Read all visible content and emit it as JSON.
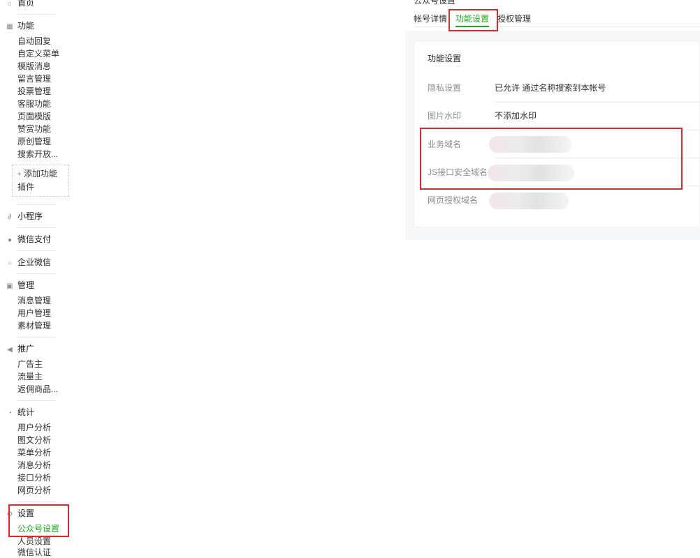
{
  "sidebar": {
    "home": {
      "label": "首页",
      "icon": "home-icon"
    },
    "functions": {
      "label": "功能",
      "icon": "grid-icon",
      "items": [
        "自动回复",
        "自定义菜单",
        "模版消息",
        "留言管理",
        "投票管理",
        "客服功能",
        "页面模版",
        "赞赏功能",
        "原创管理",
        "搜索开放..."
      ],
      "add_plugin": {
        "line1": "添加功能",
        "line2": "插件"
      }
    },
    "mini_program": {
      "label": "小程序",
      "icon": "link-icon"
    },
    "wechat_pay": {
      "label": "微信支付",
      "icon": "pay-icon"
    },
    "enterprise_wechat": {
      "label": "企业微信",
      "icon": "search-circle-icon"
    },
    "manage": {
      "label": "管理",
      "icon": "inbox-icon",
      "items": [
        "消息管理",
        "用户管理",
        "素材管理"
      ]
    },
    "promote": {
      "label": "推广",
      "icon": "megaphone-icon",
      "items": [
        "广告主",
        "流量主",
        "返佣商品..."
      ]
    },
    "stats": {
      "label": "统计",
      "icon": "pie-chart-icon",
      "items": [
        "用户分析",
        "图文分析",
        "菜单分析",
        "消息分析",
        "接口分析",
        "网页分析"
      ]
    },
    "settings": {
      "label": "设置",
      "icon": "gear-icon",
      "items": [
        "公众号设置",
        "人员设置",
        "微信认证"
      ]
    }
  },
  "header": {
    "title": "公众号设置",
    "tabs": [
      {
        "label": "帐号详情"
      },
      {
        "label": "功能设置"
      },
      {
        "label": "授权管理"
      }
    ]
  },
  "panel": {
    "title": "功能设置",
    "rows": [
      {
        "label": "隐私设置",
        "value": "已允许 通过名称搜索到本帐号"
      },
      {
        "label": "图片水印",
        "value": "不添加水印"
      },
      {
        "label": "业务域名",
        "value": ""
      },
      {
        "label": "JS接口安全域名",
        "value": ""
      },
      {
        "label": "网页授权域名",
        "value": ""
      }
    ]
  },
  "colors": {
    "accent": "#1aad19",
    "highlight": "#e3262b"
  }
}
